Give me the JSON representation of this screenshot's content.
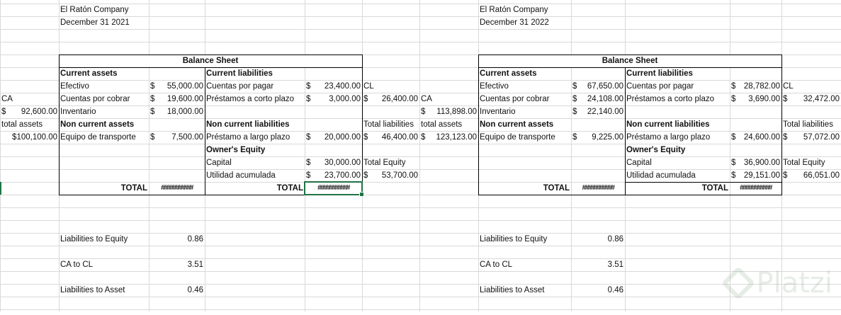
{
  "sheet": {
    "rows": [
      [
        "",
        "El Ratón Company",
        "",
        "",
        "",
        "",
        "",
        "El Ratón Company",
        "",
        "",
        "",
        ""
      ],
      [
        "",
        "December 31 2021",
        "",
        "",
        "",
        "",
        "",
        "December 31 2022",
        "",
        "",
        "",
        ""
      ],
      [
        "",
        "",
        "",
        "",
        "",
        "",
        "",
        "",
        "",
        "",
        "",
        ""
      ],
      [
        "",
        "",
        "",
        "",
        "",
        "",
        "",
        "",
        "",
        "",
        "",
        ""
      ],
      [
        "",
        "Balance Sheet",
        "",
        "",
        "",
        "",
        "",
        "Balance Sheet",
        "",
        "",
        "",
        ""
      ],
      [
        "",
        "Current assets",
        "",
        "Current liabilities",
        "",
        "",
        "",
        "Current assets",
        "",
        "Current liabilities",
        "",
        ""
      ],
      [
        "",
        "Efectivo",
        "$ 55,000.00",
        "Cuentas por pagar",
        "$ 23,400.00",
        "CL",
        "",
        "Efectivo",
        "$ 67,650.00",
        "Cuentas por pagar",
        "$ 28,782.00",
        "CL"
      ],
      [
        "CA",
        "Cuentas por cobrar",
        "$ 19,600.00",
        "Préstamos a corto plazo",
        "$ 3,000.00",
        "$ 26,400.00",
        "CA",
        "Cuentas por cobrar",
        "$ 24,108.00",
        "Préstamos a corto plazo",
        "$ 3,690.00",
        "$ 32,472.00"
      ],
      [
        "$ 92,600.00",
        "Inventario",
        "$ 18,000.00",
        "",
        "",
        "",
        "$ 113,898.00",
        "Inventario",
        "$ 22,140.00",
        "",
        "",
        ""
      ],
      [
        "total  assets",
        "Non current assets",
        "",
        "Non current liabilities",
        "",
        "Total liabilities",
        "total  assets",
        "Non current assets",
        "",
        "Non current liabilities",
        "",
        "Total liabilities"
      ],
      [
        "$100,100.00",
        "Equipo de transporte",
        "$ 7,500.00",
        "Préstamo a largo plazo",
        "$ 20,000.00",
        "$ 46,400.00",
        "$ 123,123.00",
        "Equipo de transporte",
        "$ 9,225.00",
        "Préstamo a largo plazo",
        "$ 24,600.00",
        "$ 57,072.00"
      ],
      [
        "",
        "",
        "",
        "Owner's Equity",
        "",
        "",
        "",
        "",
        "",
        "Owner's Equity",
        "",
        ""
      ],
      [
        "",
        "",
        "",
        "Capital",
        "$ 30,000.00",
        "Total Equity",
        "",
        "",
        "",
        "Capital",
        "$ 36,900.00",
        "Total Equity"
      ],
      [
        "",
        "",
        "",
        "Utilidad acumulada",
        "$ 23,700.00",
        "$ 53,700.00",
        "",
        "",
        "",
        "Utilidad acumulada",
        "$ 29,151.00",
        "$ 66,051.00"
      ],
      [
        "",
        "TOTAL",
        "###########",
        "TOTAL",
        "###########",
        "",
        "",
        "TOTAL",
        "###########",
        "TOTAL",
        "###########",
        ""
      ],
      [
        "",
        "",
        "",
        "",
        "",
        "",
        "",
        "",
        "",
        "",
        "",
        ""
      ],
      [
        "",
        "",
        "",
        "",
        "",
        "",
        "",
        "",
        "",
        "",
        "",
        ""
      ],
      [
        "",
        "",
        "",
        "",
        "",
        "",
        "",
        "",
        "",
        "",
        "",
        ""
      ],
      [
        "",
        "Liabilities to Equity",
        "0.86",
        "",
        "",
        "",
        "",
        "Liabilities to Equity",
        "0.86",
        "",
        "",
        ""
      ],
      [
        "",
        "",
        "",
        "",
        "",
        "",
        "",
        "",
        "",
        "",
        "",
        ""
      ],
      [
        "",
        "CA to CL",
        "3.51",
        "",
        "",
        "",
        "",
        "CA to CL",
        "3.51",
        "",
        "",
        ""
      ],
      [
        "",
        "",
        "",
        "",
        "",
        "",
        "",
        "",
        "",
        "",
        "",
        ""
      ],
      [
        "",
        "Liabilities to Asset",
        "0.46",
        "",
        "",
        "",
        "",
        "Liabilities to Asset",
        "0.46",
        "",
        "",
        ""
      ],
      [
        "",
        "",
        "",
        "",
        "",
        "",
        "",
        "",
        "",
        "",
        "",
        ""
      ]
    ]
  },
  "watermark": "Platzi",
  "colors": {
    "selection": "#217346",
    "gridline": "#d9d9d9"
  }
}
